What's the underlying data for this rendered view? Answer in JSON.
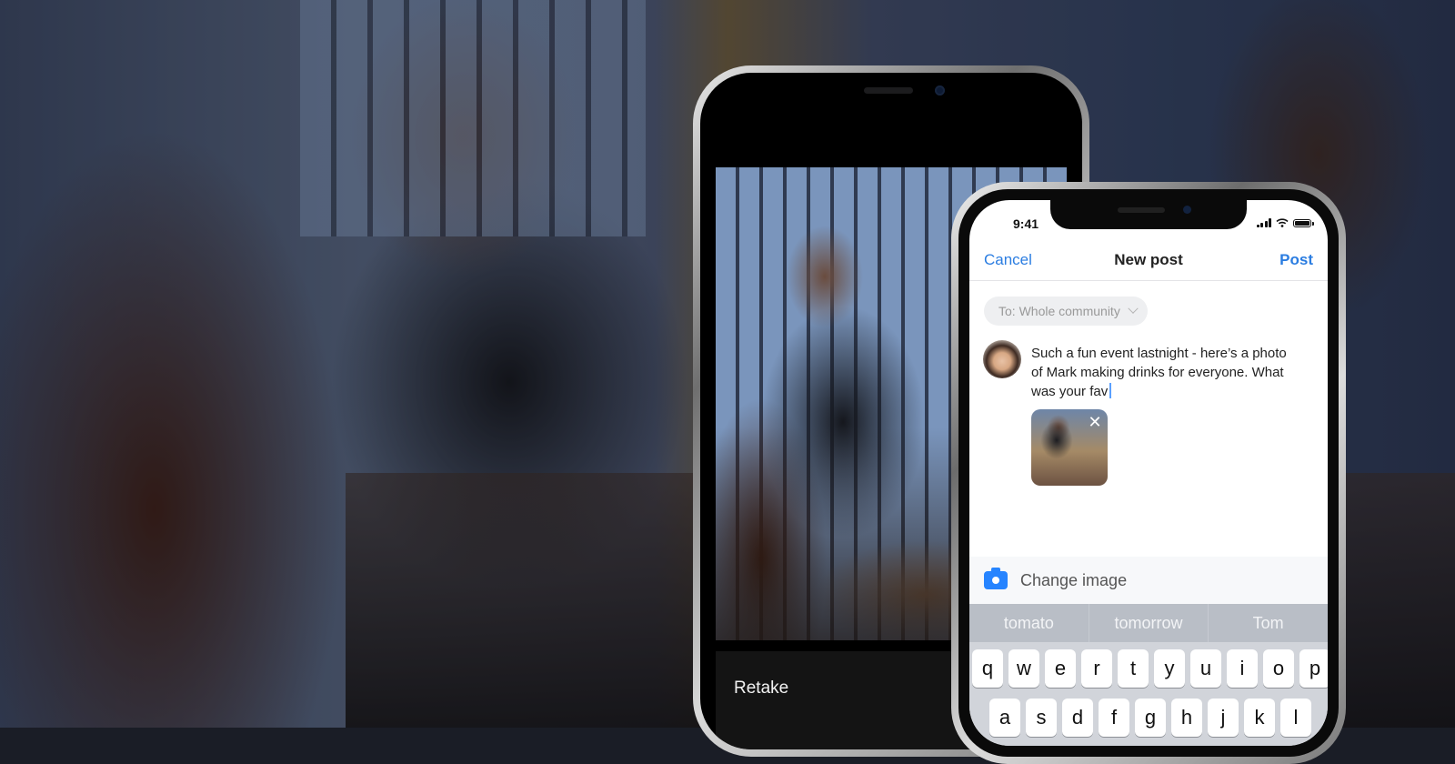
{
  "phone_left": {
    "retake_label": "Retake"
  },
  "phone_right": {
    "status_bar": {
      "time": "9:41"
    },
    "nav": {
      "cancel_label": "Cancel",
      "title": "New post",
      "post_label": "Post"
    },
    "audience": {
      "label": "To: Whole community"
    },
    "composer": {
      "text": "Such a fun event lastnight - here’s a photo of Mark making drinks for everyone. What was your fav",
      "attachment_close": "✕"
    },
    "change_image_label": "Change image",
    "suggestions": [
      "tomato",
      "tomorrow",
      "Tom"
    ],
    "keyboard": {
      "row1": [
        "q",
        "w",
        "e",
        "r",
        "t",
        "y",
        "u",
        "i",
        "o",
        "p"
      ],
      "row2": [
        "a",
        "s",
        "d",
        "f",
        "g",
        "h",
        "j",
        "k",
        "l"
      ]
    }
  },
  "colors": {
    "accent": "#2b7de1",
    "camera_icon": "#2684ff"
  }
}
